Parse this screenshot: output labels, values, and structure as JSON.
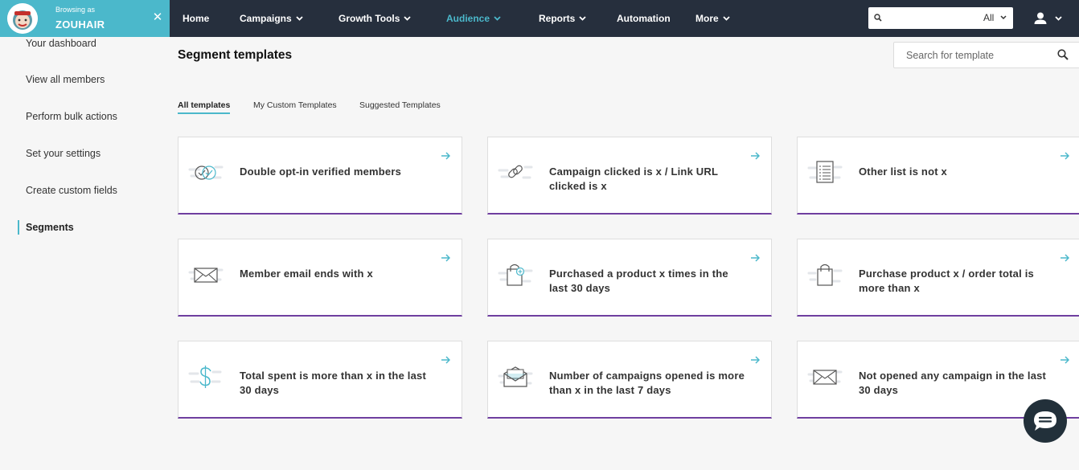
{
  "header": {
    "browsing_label": "Browsing as",
    "account_name": "ZOUHAIR",
    "nav": [
      {
        "label": "Home"
      },
      {
        "label": "Campaigns"
      },
      {
        "label": "Growth Tools"
      },
      {
        "label": "Audience"
      },
      {
        "label": "Reports"
      },
      {
        "label": "Automation"
      },
      {
        "label": "More"
      }
    ],
    "search_scope": "All",
    "colors": {
      "nav_bg": "#262f3d",
      "brand_bg": "#4bb8cb",
      "active": "#4bb8cb"
    }
  },
  "sidebar": {
    "items": [
      {
        "label": "Your dashboard"
      },
      {
        "label": "View all members"
      },
      {
        "label": "Perform bulk actions"
      },
      {
        "label": "Set your settings"
      },
      {
        "label": "Create custom fields"
      },
      {
        "label": "Segments"
      }
    ]
  },
  "main": {
    "title": "Segment templates",
    "search_placeholder": "Search for template",
    "tabs": [
      {
        "label": "All templates"
      },
      {
        "label": "My Custom Templates"
      },
      {
        "label": "Suggested Templates"
      }
    ],
    "cards": [
      {
        "icon": "verified-check-icon",
        "title": "Double opt-in verified members"
      },
      {
        "icon": "link-icon",
        "title": "Campaign clicked is x / Link URL clicked is x"
      },
      {
        "icon": "list-document-icon",
        "title": "Other list is not x"
      },
      {
        "icon": "envelope-icon",
        "title": "Member email ends with x"
      },
      {
        "icon": "shopping-bag-plus-icon",
        "title": "Purchased a product x times in the last 30 days"
      },
      {
        "icon": "shopping-bag-icon",
        "title": "Purchase product x / order total is more than x"
      },
      {
        "icon": "dollar-icon",
        "title": "Total spent is more than x in the last 30 days"
      },
      {
        "icon": "open-envelope-icon",
        "title": "Number of campaigns opened is more than x in the last 7 days"
      },
      {
        "icon": "envelope-icon",
        "title": "Not opened any campaign in the last 30 days"
      }
    ],
    "card_accent": "#6f3fa0"
  }
}
